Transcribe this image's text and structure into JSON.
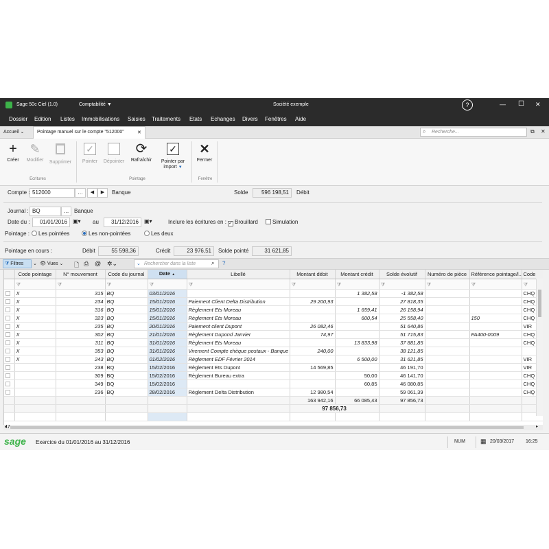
{
  "titlebar": {
    "app": "Sage 50c Ciel (1.0)",
    "module": "Comptabilité",
    "company": "Société exemple",
    "help": "?",
    "minimize": "—",
    "maximize": "☐",
    "close": "✕"
  },
  "menu": [
    "Dossier",
    "Edition",
    "Listes",
    "Immobilisations",
    "Saisies",
    "Traitements",
    "Etats",
    "Echanges",
    "Divers",
    "Fenêtres",
    "Aide"
  ],
  "tabs": {
    "home": "Accueil",
    "active": "Pointage manuel sur le compte \"512000\"",
    "close": "✕",
    "search_placeholder": "Recherche..."
  },
  "ribbon": {
    "creer": "Créer",
    "modifier": "Modifier",
    "supprimer": "Supprimer",
    "group_ecritures": "Ecritures",
    "pointer": "Pointer",
    "depointer": "Dépointer",
    "rafraichir": "Rafraîchir",
    "pointer_import_1": "Pointer par",
    "pointer_import_2": "import",
    "group_pointage": "Pointage",
    "fermer": "Fermer",
    "group_fenetre": "Fenêtre"
  },
  "form": {
    "compte_label": "Compte :",
    "compte_value": "512000",
    "compte_name": "Banque",
    "solde_label": "Solde",
    "solde_value": "596 198,51",
    "solde_sens": "Débit",
    "journal_label": "Journal :",
    "journal_value": "BQ",
    "journal_name": "Banque",
    "date_du_label": "Date du :",
    "date_du": "01/01/2016",
    "au_label": "au",
    "date_au": "31/12/2016",
    "inclure_label": "Inclure les écritures en :",
    "brouillard": "Brouillard",
    "simulation": "Simulation",
    "pointage_label": "Pointage :",
    "opt_pointees": "Les pointées",
    "opt_non_pointees": "Les non-pointées",
    "opt_deux": "Les deux",
    "encours_label": "Pointage en cours :",
    "debit_label": "Débit",
    "debit_value": "55 598,36",
    "credit_label": "Crédit",
    "credit_value": "23 976,51",
    "solde_pointe_label": "Solde pointé",
    "solde_pointe_value": "31 621,85"
  },
  "gridtool": {
    "filtres": "Filtres",
    "vues": "Vues",
    "search_placeholder": "Rechercher dans la liste",
    "help": "?"
  },
  "columns": [
    "Code pointage",
    "N° mouvement",
    "Code du journal",
    "Date",
    "Libellé",
    "Montant débit",
    "Montant crédit",
    "Solde évolutif",
    "Numéro de pièce",
    "Référence pointage/l...",
    "Code"
  ],
  "rows": [
    [
      "X",
      "315",
      "BQ",
      "03/01/2016",
      "",
      "",
      "1 382,58",
      "-1 382,58",
      "",
      "",
      "CHQ"
    ],
    [
      "X",
      "234",
      "BQ",
      "15/01/2016",
      "Paiement Client Delta Distribution",
      "29 200,93",
      "",
      "27 818,35",
      "",
      "",
      "CHQ"
    ],
    [
      "X",
      "316",
      "BQ",
      "15/01/2016",
      "Règlement Ets Moreau",
      "",
      "1 659,41",
      "26 158,94",
      "",
      "",
      "CHQ"
    ],
    [
      "X",
      "323",
      "BQ",
      "15/01/2016",
      "Règlement Ets Moreau",
      "",
      "600,54",
      "25 558,40",
      "",
      "150",
      "CHQ"
    ],
    [
      "X",
      "235",
      "BQ",
      "20/01/2016",
      "Paiement client Dupont",
      "26 082,46",
      "",
      "51 640,86",
      "",
      "",
      "VIR"
    ],
    [
      "X",
      "302",
      "BQ",
      "21/01/2016",
      "Règlement Dupond Janvier",
      "74,97",
      "",
      "51 715,83",
      "",
      "FA400-0009",
      "CHQ"
    ],
    [
      "X",
      "311",
      "BQ",
      "31/01/2016",
      "Règlement Ets Moreau",
      "",
      "13 833,98",
      "37 881,85",
      "",
      "",
      "CHQ"
    ],
    [
      "X",
      "353",
      "BQ",
      "31/01/2016",
      "Virement Compte chèque postaux - Banque",
      "240,00",
      "",
      "38 121,85",
      "",
      "",
      ""
    ],
    [
      "X",
      "243",
      "BQ",
      "01/02/2016",
      "Règlement EDF Février 2014",
      "",
      "6 500,00",
      "31 621,85",
      "",
      "",
      "VIR"
    ],
    [
      "",
      "238",
      "BQ",
      "15/02/2016",
      "Règlement Ets Dupont",
      "14 569,85",
      "",
      "46 191,70",
      "",
      "",
      "VIR"
    ],
    [
      "",
      "309",
      "BQ",
      "15/02/2016",
      "Règlement Bureau extra",
      "",
      "50,00",
      "46 141,70",
      "",
      "",
      "CHQ"
    ],
    [
      "",
      "349",
      "BQ",
      "15/02/2016",
      "",
      "",
      "60,85",
      "46 080,85",
      "",
      "",
      "CHQ"
    ],
    [
      "",
      "236",
      "BQ",
      "28/02/2016",
      "Règlement Delta Distribution",
      "12 980,54",
      "",
      "59 061,39",
      "",
      "",
      "CHQ"
    ]
  ],
  "totals": {
    "debit": "163 942,16",
    "credit": "66 085,43",
    "solde": "97 856,73",
    "grand": "97 856,73"
  },
  "status": {
    "count": "47",
    "logo": "sage",
    "exercice": "Exercice du 01/01/2016 au 31/12/2016",
    "num": "NUM",
    "date": "20/03/2017",
    "time": "16:25"
  }
}
